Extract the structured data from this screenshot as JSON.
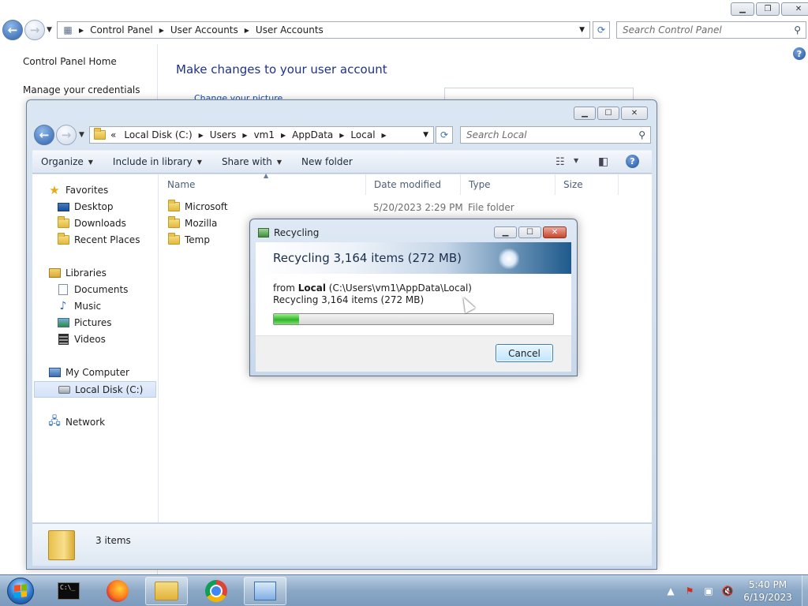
{
  "control_panel": {
    "address": [
      "Control Panel",
      "User Accounts",
      "User Accounts"
    ],
    "search_placeholder": "Search Control Panel",
    "left_pane": {
      "home": "Control Panel Home",
      "manage_credentials": "Manage your credentials"
    },
    "heading": "Make changes to your user account",
    "partial_link": "Change your picture"
  },
  "explorer": {
    "address": [
      "Local Disk (C:)",
      "Users",
      "vm1",
      "AppData",
      "Local"
    ],
    "address_prefix": "«",
    "search_placeholder": "Search Local",
    "commands": {
      "organize": "Organize",
      "include_in_library": "Include in library",
      "share_with": "Share with",
      "new_folder": "New folder"
    },
    "nav": {
      "favorites": "Favorites",
      "desktop": "Desktop",
      "downloads": "Downloads",
      "recent_places": "Recent Places",
      "libraries": "Libraries",
      "documents": "Documents",
      "music": "Music",
      "pictures": "Pictures",
      "videos": "Videos",
      "my_computer": "My Computer",
      "local_disk": "Local Disk (C:)",
      "network": "Network"
    },
    "columns": {
      "name": "Name",
      "date_modified": "Date modified",
      "type": "Type",
      "size": "Size"
    },
    "files": [
      {
        "name": "Microsoft",
        "date": "5/20/2023 2:29 PM",
        "type": "File folder"
      },
      {
        "name": "Mozilla",
        "date": "",
        "type": ""
      },
      {
        "name": "Temp",
        "date": "",
        "type": ""
      }
    ],
    "item_count": "3 items"
  },
  "dialog": {
    "title": "Recycling",
    "banner": "Recycling 3,164 items (272 MB)",
    "from_label": "from ",
    "from_name": "Local",
    "from_path": " (C:\\Users\\vm1\\AppData\\Local)",
    "status": "Recycling 3,164 items (272 MB)",
    "progress_fraction": 0.09,
    "cancel": "Cancel"
  },
  "taskbar": {
    "time": "5:40 PM",
    "date": "6/19/2023",
    "cmd_text": "C:\\_"
  },
  "colors": {
    "accent": "#1e3287",
    "progress": "#2fb52a"
  }
}
